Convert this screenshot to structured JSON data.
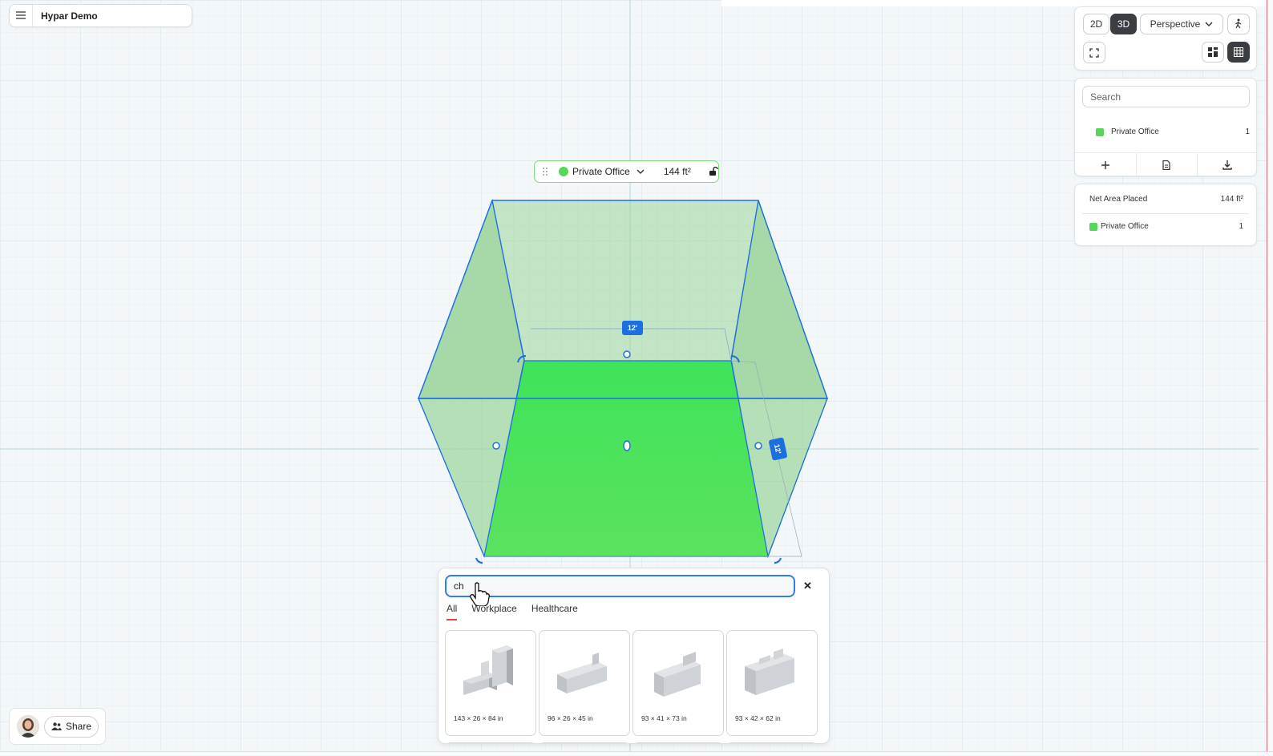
{
  "app": {
    "title": "Hypar Demo"
  },
  "view_controls": {
    "mode_2d": "2D",
    "mode_3d": "3D",
    "active_mode": "3D",
    "projection": "Perspective"
  },
  "layers": {
    "search_placeholder": "Search",
    "items": [
      {
        "label": "Private Office",
        "count": "1",
        "color": "#55d85a"
      }
    ]
  },
  "summary": {
    "net_area_label": "Net Area Placed",
    "net_area_value": "144 ft²",
    "items": [
      {
        "label": "Private Office",
        "count": "1",
        "color": "#55d85a"
      }
    ]
  },
  "room_label": {
    "name": "Private Office",
    "area": "144 ft²",
    "color": "#55d85a"
  },
  "dimensions": {
    "top": "12'",
    "right": "12'"
  },
  "catalog": {
    "query": "ch",
    "tabs": [
      "All",
      "Workplace",
      "Healthcare"
    ],
    "active_tab": "All",
    "items": [
      {
        "dims": "143 × 26 × 84 in",
        "icon": "furniture-cabinet-tall-icon"
      },
      {
        "dims": "96 × 26 × 45 in",
        "icon": "furniture-counter-icon"
      },
      {
        "dims": "93 × 41 × 73 in",
        "icon": "furniture-station-icon"
      },
      {
        "dims": "93 × 42 × 62 in",
        "icon": "furniture-desk-icon"
      }
    ]
  },
  "footer": {
    "share_label": "Share"
  },
  "colors": {
    "accent": "#1b6fe0",
    "room_fill": "#55d85a",
    "tab_underline": "#e0444f"
  }
}
